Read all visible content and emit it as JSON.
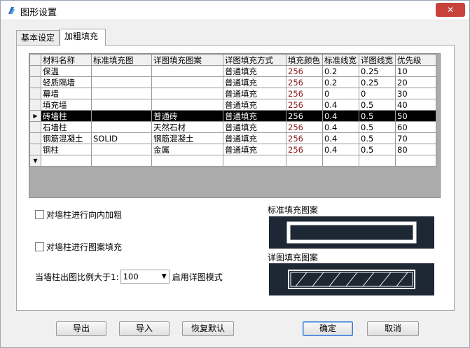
{
  "window": {
    "title": "图形设置",
    "close_label": "✕"
  },
  "tabs": [
    {
      "label": "基本设定",
      "active": false
    },
    {
      "label": "加粗填充",
      "active": true
    }
  ],
  "grid": {
    "columns": [
      "材料名称",
      "标准填充图",
      "详图填充图案",
      "详图填充方式",
      "填充颜色",
      "标准线宽",
      "详图线宽",
      "优先级"
    ],
    "rows": [
      {
        "name": "保温",
        "std_fill": "",
        "detail_pattern": "",
        "detail_method": "普通填充",
        "color": "256",
        "std_width": "0.2",
        "detail_width": "0.25",
        "priority": "10",
        "marker": ""
      },
      {
        "name": "轻质隔墙",
        "std_fill": "",
        "detail_pattern": "",
        "detail_method": "普通填充",
        "color": "256",
        "std_width": "0.2",
        "detail_width": "0.25",
        "priority": "20",
        "marker": ""
      },
      {
        "name": "幕墙",
        "std_fill": "",
        "detail_pattern": "",
        "detail_method": "普通填充",
        "color": "256",
        "std_width": "0",
        "detail_width": "0",
        "priority": "30",
        "marker": ""
      },
      {
        "name": "填充墙",
        "std_fill": "",
        "detail_pattern": "",
        "detail_method": "普通填充",
        "color": "256",
        "std_width": "0.4",
        "detail_width": "0.5",
        "priority": "40",
        "marker": ""
      },
      {
        "name": "砖墙柱",
        "std_fill": "",
        "detail_pattern": "普通砖",
        "detail_method": "普通填充",
        "color": "256",
        "std_width": "0.4",
        "detail_width": "0.5",
        "priority": "50",
        "marker": "▶"
      },
      {
        "name": "石墙柱",
        "std_fill": "",
        "detail_pattern": "天然石材",
        "detail_method": "普通填充",
        "color": "256",
        "std_width": "0.4",
        "detail_width": "0.5",
        "priority": "60",
        "marker": ""
      },
      {
        "name": "钢筋混凝土",
        "std_fill": "SOLID",
        "detail_pattern": "钢筋混凝土",
        "detail_method": "普通填充",
        "color": "256",
        "std_width": "0.4",
        "detail_width": "0.5",
        "priority": "70",
        "marker": ""
      },
      {
        "name": "钢柱",
        "std_fill": "",
        "detail_pattern": "金属",
        "detail_method": "普通填充",
        "color": "256",
        "std_width": "0.4",
        "detail_width": "0.5",
        "priority": "80",
        "marker": ""
      },
      {
        "name": "",
        "std_fill": "",
        "detail_pattern": "",
        "detail_method": "",
        "color": "",
        "std_width": "",
        "detail_width": "",
        "priority": "",
        "marker": "▼"
      }
    ],
    "selected_row": 4
  },
  "options": {
    "inward_bold_label": "对墙柱进行向内加粗",
    "pattern_fill_label": "对墙柱进行图案填充",
    "scale_prefix": "当墙柱出图比例大于1:",
    "scale_value": "100",
    "scale_suffix": "启用详图模式"
  },
  "preview": {
    "standard_label": "标准填充图案",
    "detail_label": "详图填充图案"
  },
  "buttons": {
    "export": "导出",
    "import": "导入",
    "restore": "恢复默认",
    "ok": "确定",
    "cancel": "取消"
  }
}
